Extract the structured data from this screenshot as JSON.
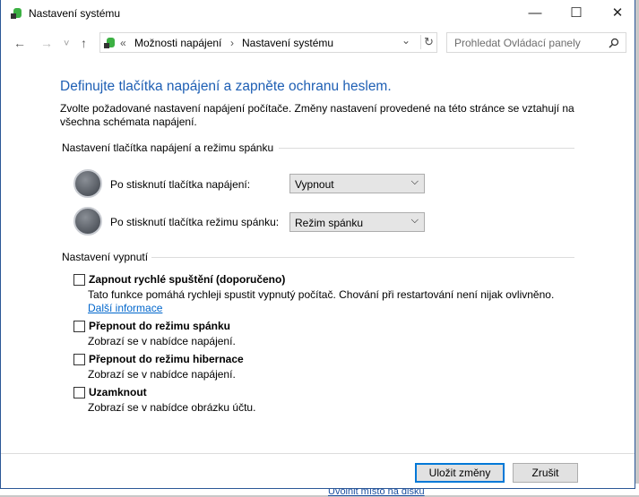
{
  "window": {
    "title": "Nastavení systému",
    "minimize": "—",
    "maximize": "☐",
    "close": "✕"
  },
  "nav": {
    "back": "←",
    "forward": "→",
    "recent": "˅",
    "up": "↑",
    "refresh": "↻"
  },
  "address": {
    "sep": "«",
    "crumbs": [
      "Možnosti napájení",
      "Nastavení systému"
    ],
    "arrow": "›",
    "dropdown": "⌄"
  },
  "search": {
    "placeholder": "Prohledat Ovládací panely"
  },
  "heading": "Definujte tlačítka napájení a zapněte ochranu heslem.",
  "description": "Zvolte požadované nastavení napájení počítače. Změny nastavení provedené na této stránce se vztahují na všechna schémata napájení.",
  "buttons_section": {
    "title": "Nastavení tlačítka napájení a režimu spánku",
    "rows": [
      {
        "label": "Po stisknutí tlačítka napájení:",
        "value": "Vypnout"
      },
      {
        "label": "Po stisknutí tlačítka režimu spánku:",
        "value": "Režim spánku"
      }
    ]
  },
  "shutdown_section": {
    "title": "Nastavení vypnutí",
    "items": [
      {
        "label": "Zapnout rychlé spuštění (doporučeno)",
        "desc": "Tato funkce pomáhá rychleji spustit vypnutý počítač. Chování při restartování není nijak ovlivněno.",
        "link": "Další informace",
        "checked": false
      },
      {
        "label": "Přepnout do režimu spánku",
        "desc": "Zobrazí se v nabídce napájení.",
        "checked": false
      },
      {
        "label": "Přepnout do režimu hibernace",
        "desc": "Zobrazí se v nabídce napájení.",
        "checked": false
      },
      {
        "label": "Uzamknout",
        "desc": "Zobrazí se v nabídce obrázku účtu.",
        "checked": false
      }
    ]
  },
  "footer": {
    "save": "Uložit změny",
    "cancel": "Zrušit"
  },
  "background": {
    "text": "Uvolnit místo na disku"
  }
}
